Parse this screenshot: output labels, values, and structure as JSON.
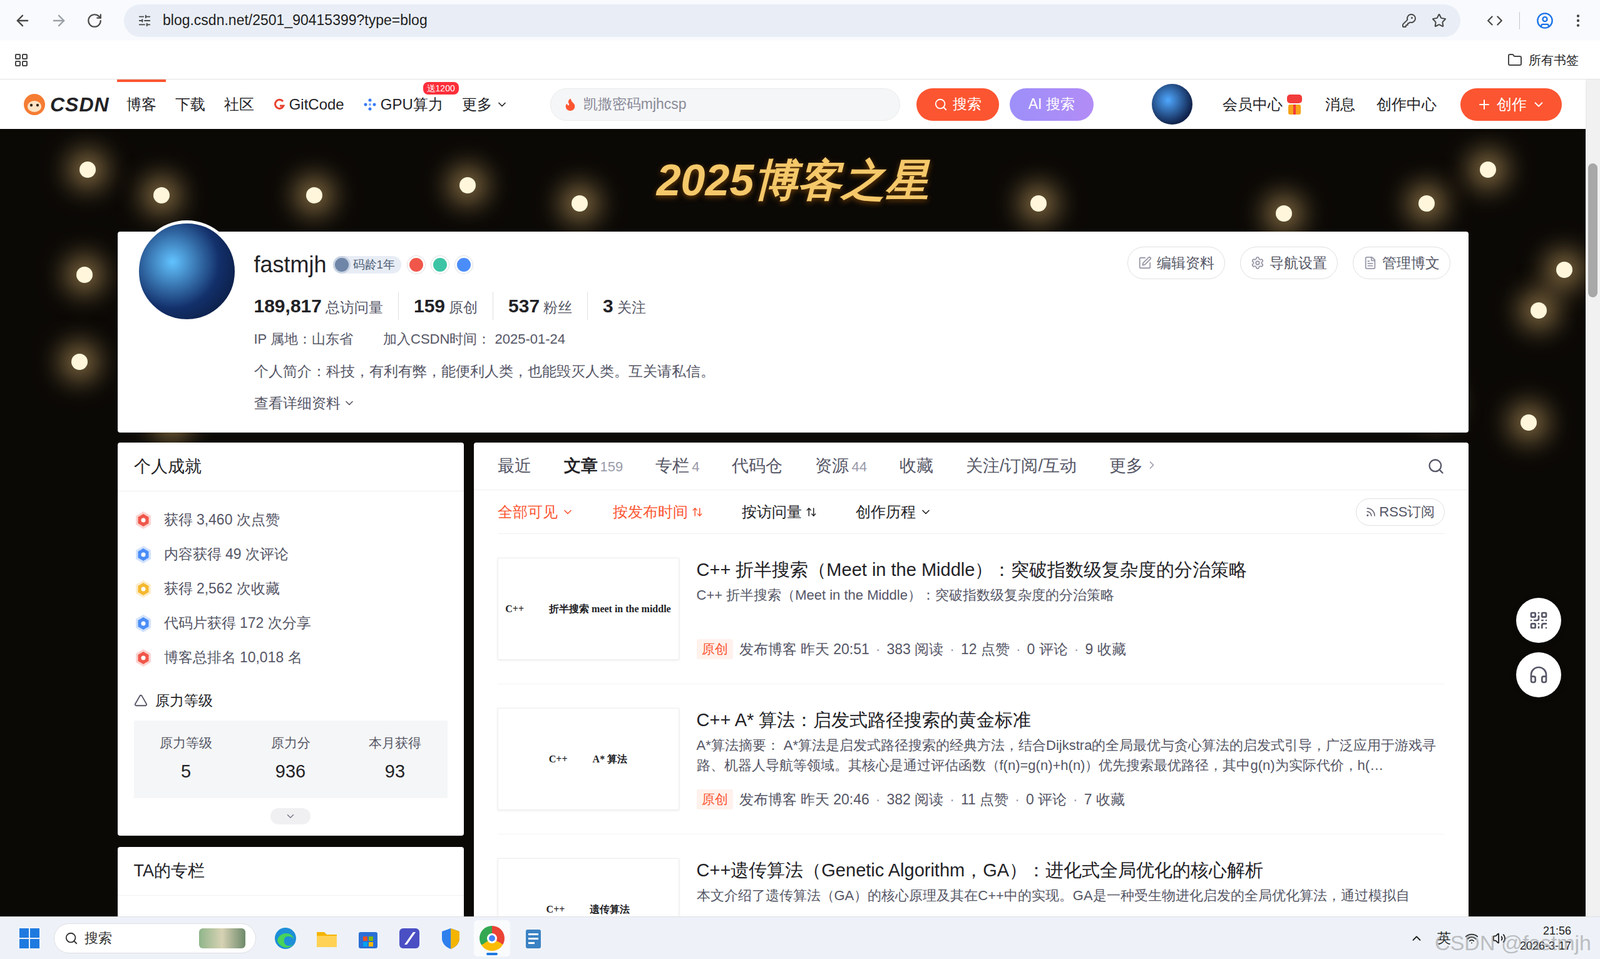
{
  "browser": {
    "url": "blog.csdn.net/2501_90415399?type=blog",
    "bookmarks": "所有书签"
  },
  "nav": {
    "logo": "CSDN",
    "items": [
      {
        "label": "博客",
        "selected": true,
        "kind": "plain"
      },
      {
        "label": "下载",
        "selected": false,
        "kind": "plain"
      },
      {
        "label": "社区",
        "selected": false,
        "kind": "plain"
      },
      {
        "label": "GitCode",
        "selected": false,
        "kind": "gitcode"
      },
      {
        "label": "GPU算力",
        "selected": false,
        "kind": "gpu",
        "badge": "送1200"
      },
      {
        "label": "更多",
        "selected": false,
        "kind": "more"
      }
    ],
    "search": {
      "placeholder": "凯撒密码mjhcsp",
      "button": "搜索",
      "ai_button": "AI 搜索"
    },
    "links": [
      "会员中心",
      "消息",
      "创作中心"
    ],
    "create_button": "创作"
  },
  "banner": {
    "title": "2025博客之星"
  },
  "profile": {
    "name": "fastmjh",
    "age_badge": "码龄1年",
    "marks": [
      {
        "color": "#f0574a"
      },
      {
        "color": "#3cc4a5"
      },
      {
        "color": "#4b8df8"
      }
    ],
    "stats": [
      {
        "value": "189,817",
        "label": "总访问量"
      },
      {
        "value": "159",
        "label": "原创"
      },
      {
        "value": "537",
        "label": "粉丝"
      },
      {
        "value": "3",
        "label": "关注"
      }
    ],
    "ip": "IP 属地：山东省",
    "joined_label": "加入CSDN时间：",
    "joined": "2025-01-24",
    "bio": "个人简介：科技，有利有弊，能便利人类，也能毁灭人类。互关请私信。",
    "details": "查看详细资料",
    "buttons": [
      {
        "label": "编辑资料",
        "kind": "edit"
      },
      {
        "label": "导航设置",
        "kind": "settings"
      },
      {
        "label": "管理博文",
        "kind": "manage"
      }
    ]
  },
  "achievements": {
    "title": "个人成就",
    "items": [
      {
        "text": "获得 3,460 次点赞",
        "color": "#f0574a"
      },
      {
        "text": "内容获得 49 次评论",
        "color": "#4b8df8"
      },
      {
        "text": "获得 2,562 次收藏",
        "color": "#f5b82e"
      },
      {
        "text": "代码片获得 172 次分享",
        "color": "#4b8df8"
      },
      {
        "text": "博客总排名 10,018 名",
        "color": "#f0574a"
      }
    ],
    "level_title": "原力等级",
    "level_cells": [
      {
        "label": "原力等级",
        "value": "5"
      },
      {
        "label": "原力分",
        "value": "936"
      },
      {
        "label": "本月获得",
        "value": "93"
      }
    ],
    "expanded": false
  },
  "columns_card": {
    "title": "TA的专栏"
  },
  "tabs": [
    {
      "label": "最近",
      "kind": "tab",
      "selected": false
    },
    {
      "label": "文章",
      "count": "159",
      "kind": "tab",
      "selected": true
    },
    {
      "label": "专栏",
      "count": "4",
      "kind": "tab",
      "selected": false
    },
    {
      "label": "代码仓",
      "kind": "tab",
      "selected": false
    },
    {
      "label": "资源",
      "count": "44",
      "kind": "tab",
      "selected": false
    },
    {
      "label": "收藏",
      "kind": "tab",
      "selected": false
    },
    {
      "label": "关注/订阅/互动",
      "kind": "tab",
      "selected": false
    },
    {
      "label": "更多",
      "kind": "more",
      "selected": false
    }
  ],
  "filters": [
    {
      "label": "全部可见",
      "kind": "dropdown",
      "selected": true
    },
    {
      "label": "按发布时间",
      "kind": "sort",
      "selected": true
    },
    {
      "label": "按访问量",
      "kind": "sort",
      "selected": false
    },
    {
      "label": "创作历程",
      "kind": "dropdown",
      "selected": false
    }
  ],
  "rss": "RSS订阅",
  "separator": "·",
  "articles": [
    {
      "title": "C++ 折半搜索（Meet in the Middle）：突破指数级复杂度的分治策略",
      "summary": "C++ 折半搜索（Meet in the Middle）：突破指数级复杂度的分治策略",
      "cover": [
        "C++",
        "折半搜索 meet in the middle"
      ],
      "tag": "原创",
      "published": "发布博客 昨天 20:51",
      "stats": [
        "383 阅读",
        "12 点赞",
        "0 评论",
        "9 收藏"
      ]
    },
    {
      "title": "C++ A* 算法：启发式路径搜索的黄金标准",
      "summary": "A*算法摘要： A*算法是启发式路径搜索的经典方法，结合Dijkstra的全局最优与贪心算法的启发式引导，广泛应用于游戏寻路、机器人导航等领域。其核心是通过评估函数（f(n)=g(n)+h(n)）优先搜索最优路径，其中g(n)为实际代价，h(…",
      "cover": [
        "C++",
        "A* 算法"
      ],
      "tag": "原创",
      "published": "发布博客 昨天 20:46",
      "stats": [
        "382 阅读",
        "11 点赞",
        "0 评论",
        "7 收藏"
      ]
    },
    {
      "title": "C++遗传算法（Genetic Algorithm，GA）：进化式全局优化的核心解析",
      "summary": "本文介绍了遗传算法（GA）的核心原理及其在C++中的实现。GA是一种受生物进化启发的全局优化算法，通过模拟自",
      "cover": [
        "C++",
        "遗传算法"
      ]
    }
  ],
  "scrollbar": {
    "offset": 0.1,
    "level": 0.16
  },
  "taskbar": {
    "search": "搜索",
    "apps": [
      {
        "kind": "edge",
        "selected": false
      },
      {
        "kind": "files",
        "selected": false
      },
      {
        "kind": "store",
        "selected": false
      },
      {
        "kind": "studio",
        "selected": false
      },
      {
        "kind": "shield",
        "selected": false
      },
      {
        "kind": "chrome",
        "selected": true
      },
      {
        "kind": "notepad",
        "selected": false
      }
    ],
    "ime": "英",
    "time": "21:56",
    "date": "2026-3-17"
  },
  "watermark": "CSDN @fastmjh"
}
